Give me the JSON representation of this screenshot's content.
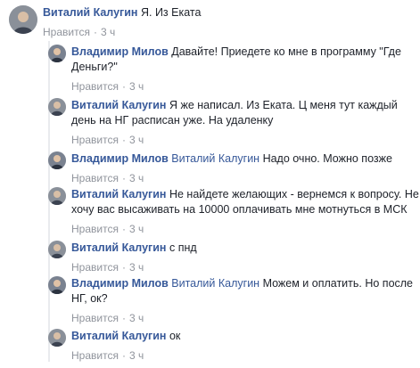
{
  "comments": [
    {
      "author": "Виталий Калугин",
      "mention": "",
      "text": "Я. Из Еката",
      "like": "Нравится",
      "time": "3 ч"
    },
    {
      "author": "Владимир Милов",
      "mention": "",
      "text": "Давайте! Приедете ко мне в программу \"Где Деньги?\"",
      "like": "Нравится",
      "time": "3 ч"
    },
    {
      "author": "Виталий Калугин",
      "mention": "",
      "text": "Я же написал. Из Еката. Ц меня тут каждый день на НГ расписан уже. На удаленку",
      "like": "Нравится",
      "time": "3 ч"
    },
    {
      "author": "Владимир Милов",
      "mention": "Виталий Калугин",
      "text": "Надо очно. Можно позже",
      "like": "Нравится",
      "time": "3 ч"
    },
    {
      "author": "Виталий Калугин",
      "mention": "",
      "text": "Не найдете желающих - вернемся к вопросу. Не хочу вас высаживать на 10000 оплачивать мне мотнуться в МСК",
      "like": "Нравится",
      "time": "3 ч"
    },
    {
      "author": "Виталий Калугин",
      "mention": "",
      "text": "с пнд",
      "like": "Нравится",
      "time": "3 ч"
    },
    {
      "author": "Владимир Милов",
      "mention": "Виталий Калугин",
      "text": "Можем и оплатить. Но после НГ, ок?",
      "like": "Нравится",
      "time": "3 ч"
    },
    {
      "author": "Виталий Калугин",
      "mention": "",
      "text": "ок",
      "like": "Нравится",
      "time": "3 ч"
    }
  ]
}
